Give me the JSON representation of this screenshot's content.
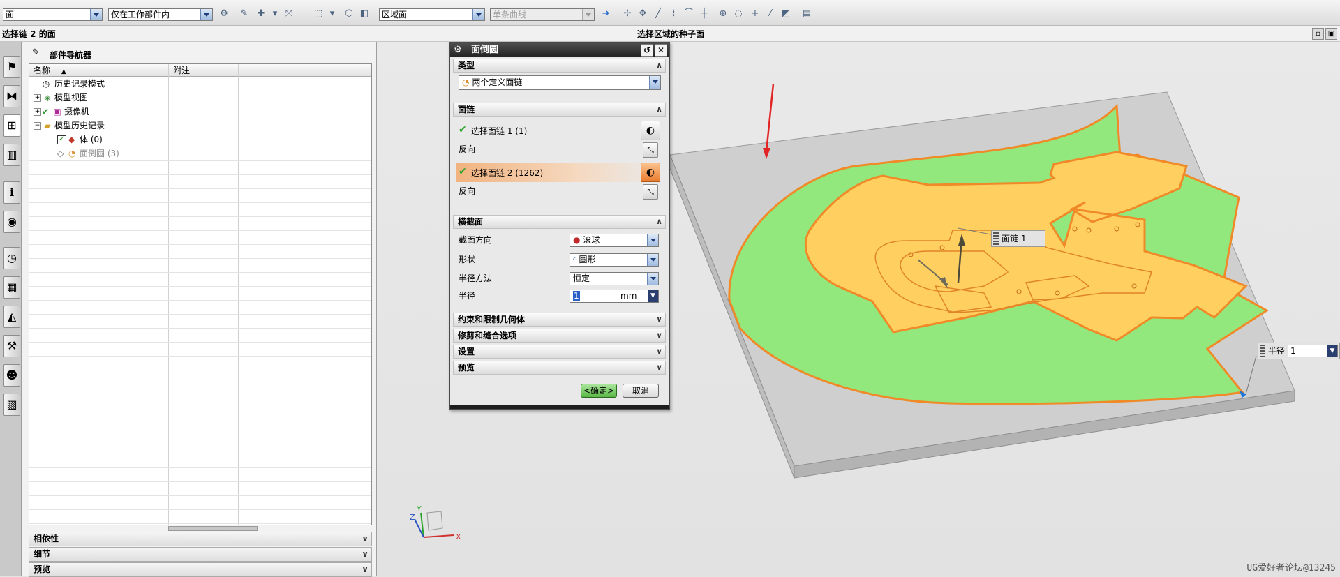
{
  "toolbar": {
    "filter_type": "面",
    "scope": "仅在工作部件内",
    "face_rule": "区域面",
    "curve_rule": "单条曲线"
  },
  "status": {
    "prompt": "选择链 2 的面",
    "selection_hint": "选择区域的种子面"
  },
  "navigator": {
    "title": "部件导航器",
    "columns": [
      "名称",
      "附注"
    ],
    "items": [
      {
        "label": "历史记录模式",
        "icon": "clock-icon"
      },
      {
        "label": "模型视图",
        "icon": "views-icon"
      },
      {
        "label": "摄像机",
        "icon": "camera-icon"
      },
      {
        "label": "模型历史记录",
        "icon": "folder-icon"
      },
      {
        "label": "体 (0)",
        "icon": "body-icon"
      },
      {
        "label": "面倒圆 (3)",
        "icon": "face-blend-icon"
      }
    ],
    "panels": [
      "相依性",
      "细节",
      "预览"
    ]
  },
  "dialog": {
    "title": "面倒圆",
    "sections": {
      "type": "类型",
      "face_chain": "面链",
      "cross_section": "横截面",
      "constraints": "约束和限制几何体",
      "trim": "修剪和缝合选项",
      "settings": "设置",
      "preview": "预览"
    },
    "type_value": "两个定义面链",
    "chain1_label": "选择面链 1 (1)",
    "chain2_label": "选择面链 2 (1262)",
    "reverse_label": "反向",
    "section_orientation_label": "截面方向",
    "section_orientation_value": "滚球",
    "shape_label": "形状",
    "shape_value": "圆形",
    "radius_method_label": "半径方法",
    "radius_method_value": "恒定",
    "radius_label": "半径",
    "radius_value": "1",
    "radius_unit": "mm",
    "ok_label": "<确定>",
    "cancel_label": "取消"
  },
  "viewport": {
    "face_chain_label": "面链 1",
    "radius_label": "半径",
    "radius_value": "1",
    "axes": {
      "x": "X",
      "y": "Y",
      "z": "Z"
    },
    "watermark": "UG爱好者论坛@13245"
  },
  "colors": {
    "chain1_face": "#92e87c",
    "chain2_face": "#ffd060",
    "edge_highlight": "#f08a28",
    "active_row": "#f1b37f"
  }
}
